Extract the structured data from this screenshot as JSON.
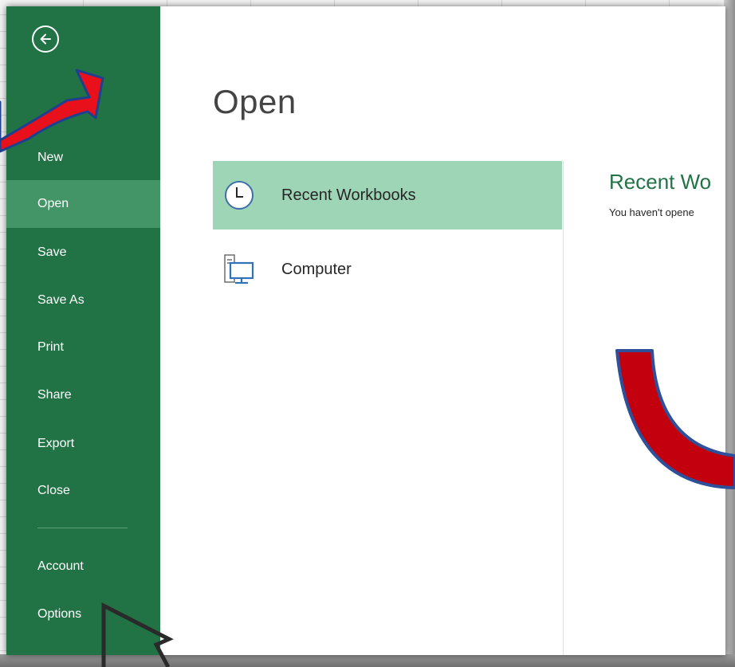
{
  "sidebar": {
    "back_label": "",
    "items": [
      {
        "label": "New"
      },
      {
        "label": "Open"
      },
      {
        "label": "Save"
      },
      {
        "label": "Save As"
      },
      {
        "label": "Print"
      },
      {
        "label": "Share"
      },
      {
        "label": "Export"
      },
      {
        "label": "Close"
      },
      {
        "label": "Account"
      },
      {
        "label": "Options"
      }
    ],
    "active_item": "Open"
  },
  "main": {
    "title": "Open",
    "places": [
      {
        "label": "Recent Workbooks",
        "icon": "clock-icon",
        "selected": true
      },
      {
        "label": "Computer",
        "icon": "computer-icon",
        "selected": false
      }
    ],
    "recent": {
      "heading": "Recent Wo",
      "message": "You haven't opene"
    }
  },
  "colors": {
    "sidebar": "#217346",
    "sidebar_active": "#439467",
    "place_selected": "#9fd5b7",
    "accent_text": "#217346",
    "annotation_arrow": "#e8101a"
  },
  "annotations": [
    {
      "type": "red-arrow",
      "points_to": "back-button"
    },
    {
      "type": "outline-arrow",
      "points_to": "options"
    },
    {
      "type": "curved-red-arrow",
      "points_to": "recent-workbooks-area"
    }
  ]
}
